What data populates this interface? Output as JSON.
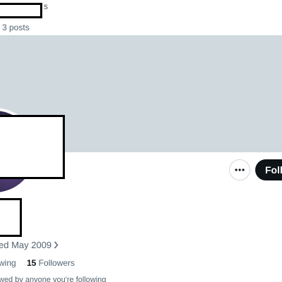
{
  "header": {
    "name_tail": "s",
    "post_count": "3 posts"
  },
  "actions": {
    "more_icon": "more-horizontal-icon",
    "follow_label": "Follow"
  },
  "profile": {
    "joined": "ed May 2009",
    "following_label": "wing",
    "followers_count": "15",
    "followers_label": "Followers",
    "followed_by": "wed by anyone you're following"
  },
  "colors": {
    "banner": "#cfd9de",
    "follow_button": "#0f1419",
    "secondary_text": "#536471"
  }
}
